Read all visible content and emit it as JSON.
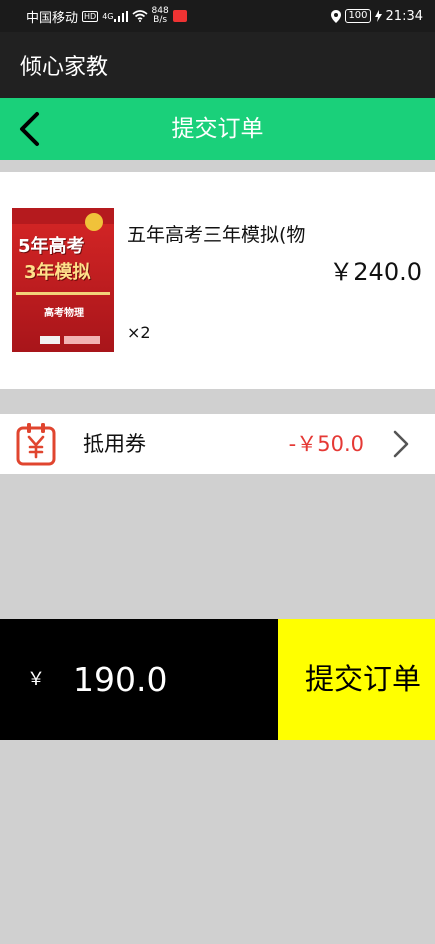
{
  "status_bar": {
    "carrier": "中国移动",
    "hd": "HD",
    "signal": "4G",
    "net_speed_value": "848",
    "net_speed_unit": "B/s",
    "battery": "100",
    "time": "21:34"
  },
  "app_bar": {
    "title": "倾心家教"
  },
  "header": {
    "title": "提交订单"
  },
  "product": {
    "cover_title_line1": "5年高考",
    "cover_title_line2": "3年模拟",
    "cover_subject": "高考物理",
    "name": "五年高考三年模拟(物",
    "price": "￥240.0",
    "quantity": "×2"
  },
  "coupon": {
    "label": "抵用券",
    "value": "-￥50.0"
  },
  "footer": {
    "currency": "￥",
    "total": "190.0",
    "submit_label": "提交订单"
  },
  "colors": {
    "header_bg": "#1ad07a",
    "app_bar_bg": "#212121",
    "discount": "#e53935",
    "submit_bg": "#ffff00",
    "total_bg": "#000000"
  }
}
